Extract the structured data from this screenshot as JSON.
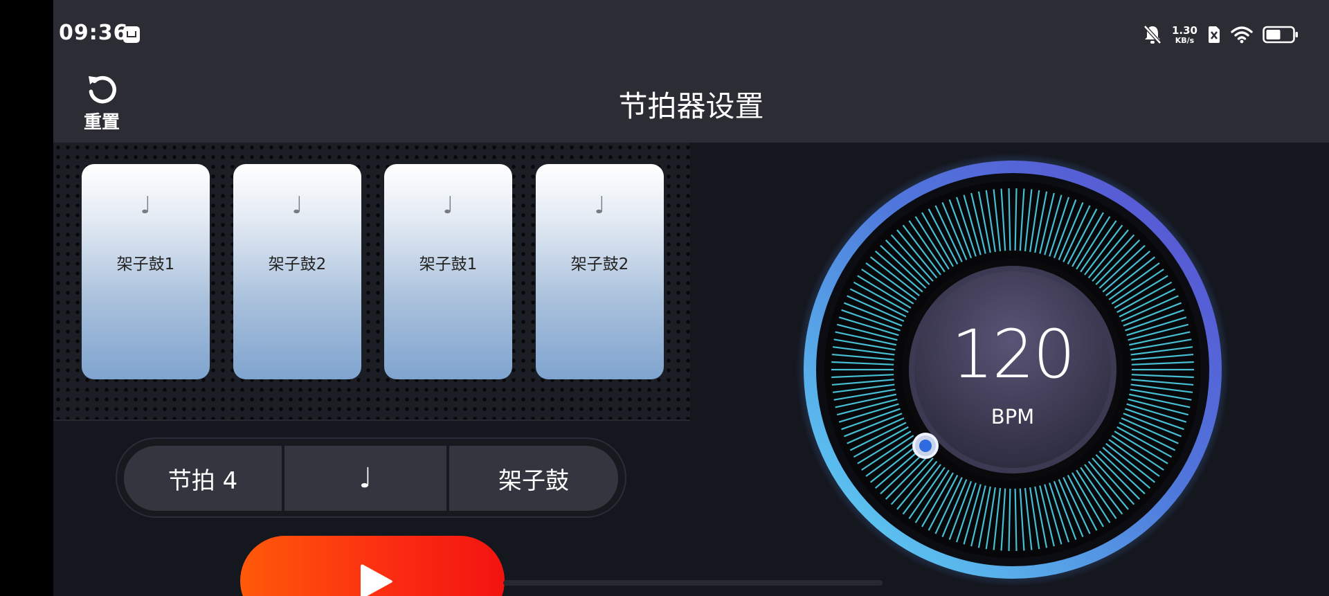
{
  "status_bar": {
    "time": "09:36",
    "net_rate_value": "1.30",
    "net_rate_unit": "KB/s",
    "icons": [
      "app-notification-icon",
      "bell-muted-icon",
      "sim-off-icon",
      "wifi-icon",
      "battery-icon"
    ]
  },
  "header": {
    "reset_label": "重置",
    "title": "节拍器设置"
  },
  "beats": [
    {
      "note": "♩",
      "label": "架子鼓1"
    },
    {
      "note": "♩",
      "label": "架子鼓2"
    },
    {
      "note": "♩",
      "label": "架子鼓1"
    },
    {
      "note": "♩",
      "label": "架子鼓2"
    }
  ],
  "controls": {
    "beat_label": "节拍 4",
    "note_symbol": "♩",
    "sound_label": "架子鼓"
  },
  "tempo": {
    "bpm": "120",
    "unit": "BPM"
  },
  "colors": {
    "play_button": "#fb2a12",
    "dial_accent": "#4fd3ea",
    "dial_ring_start": "#5fd8f5",
    "dial_ring_end": "#5b4fd1"
  }
}
